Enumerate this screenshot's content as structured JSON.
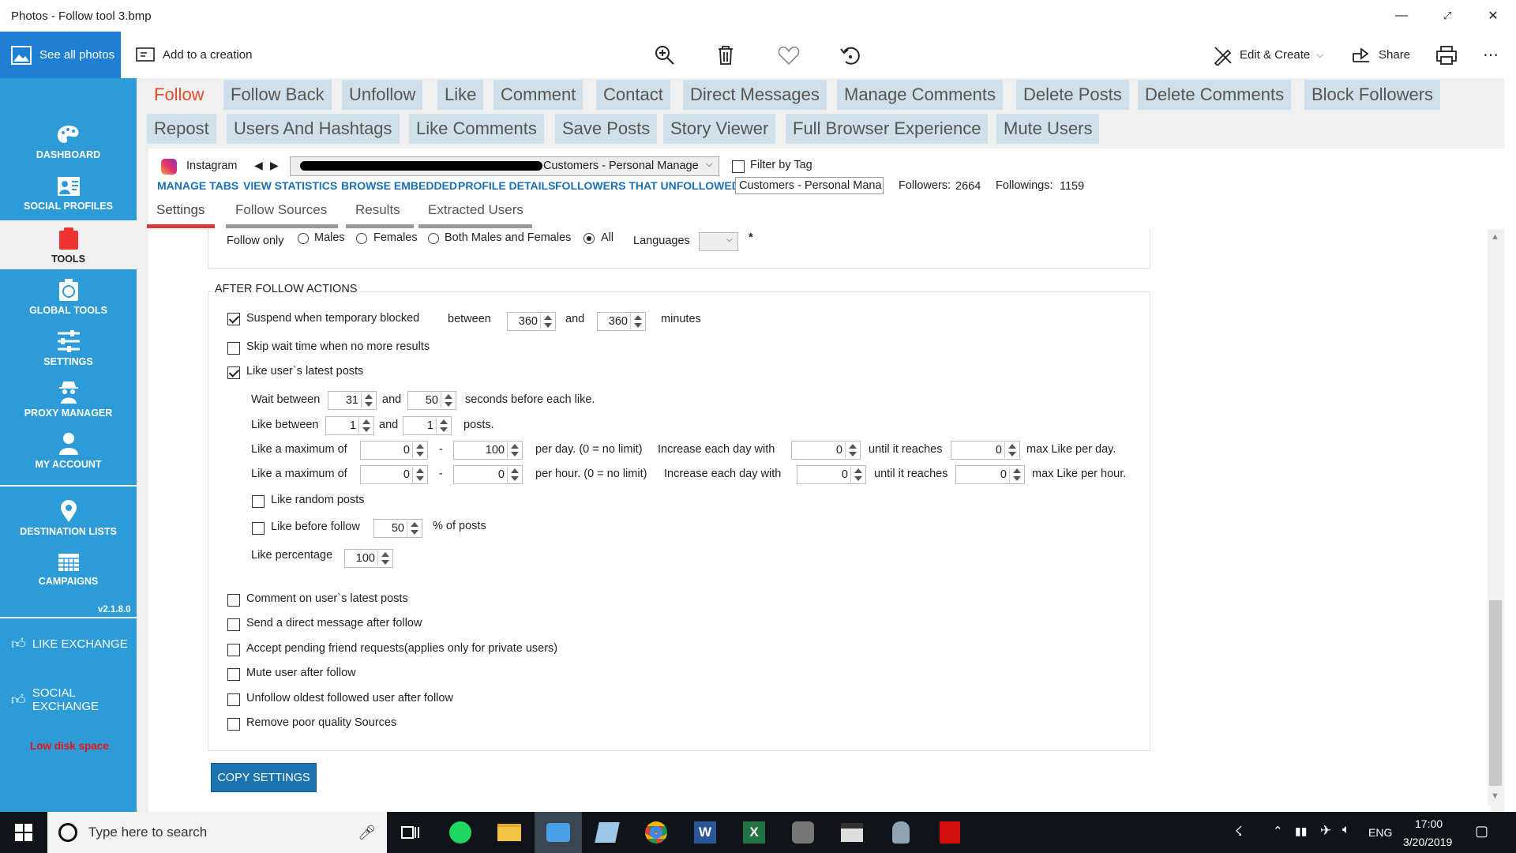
{
  "window": {
    "title": "Photos - Follow tool 3.bmp"
  },
  "photos_toolbar": {
    "see_all": "See all photos",
    "add_to_creation": "Add to a creation",
    "edit_create": "Edit & Create",
    "share": "Share"
  },
  "sidebar": {
    "items": [
      {
        "label": "DASHBOARD",
        "icon": "palette-icon"
      },
      {
        "label": "SOCIAL PROFILES",
        "icon": "profiles-icon"
      },
      {
        "label": "TOOLS",
        "icon": "clipboard-icon"
      },
      {
        "label": "GLOBAL TOOLS",
        "icon": "global-tools-icon"
      },
      {
        "label": "SETTINGS",
        "icon": "sliders-icon"
      },
      {
        "label": "PROXY MANAGER",
        "icon": "spy-icon"
      },
      {
        "label": "MY ACCOUNT",
        "icon": "user-icon"
      },
      {
        "label": "DESTINATION LISTS",
        "icon": "pin-icon"
      },
      {
        "label": "CAMPAIGNS",
        "icon": "calendar-icon"
      }
    ],
    "version": "v2.1.8.0",
    "like_exchange": "LIKE EXCHANGE",
    "social_exchange": "SOCIAL EXCHANGE",
    "warning": "Low disk space"
  },
  "tabs_row1": [
    "Follow",
    "Follow Back",
    "Unfollow",
    "Like",
    "Comment",
    "Contact",
    "Direct Messages",
    "Manage Comments",
    "Delete Posts",
    "Delete Comments",
    "Block Followers"
  ],
  "tabs_row2": [
    "Repost",
    "Users And Hashtags",
    "Like Comments",
    "Save Posts",
    "Story Viewer",
    "Full Browser Experience",
    "Mute Users"
  ],
  "account": {
    "network": "Instagram",
    "account_select": "Customers - Personal Manage",
    "filter_by_tag": "Filter by Tag",
    "tag_value": "Customers - Personal Mana",
    "followers_label": "Followers:",
    "followers": "2664",
    "followings_label": "Followings:",
    "followings": "1159",
    "links": [
      "MANAGE TABS",
      "VIEW STATISTICS",
      "BROWSE EMBEDDED",
      "PROFILE DETAILS",
      "FOLLOWERS THAT UNFOLLOWED"
    ]
  },
  "subtabs": [
    "Settings",
    "Follow Sources",
    "Results",
    "Extracted Users"
  ],
  "follow_only": {
    "label": "Follow only",
    "options": [
      "Males",
      "Females",
      "Both Males and Females",
      "All"
    ],
    "languages": "Languages",
    "asterisk": "*"
  },
  "after_follow": {
    "heading": "AFTER FOLLOW ACTIONS",
    "suspend": "Suspend when temporary blocked",
    "between": "between",
    "and": "and",
    "minutes": "minutes",
    "suspend_min": "360",
    "suspend_max": "360",
    "skip_wait": "Skip wait time when no more results",
    "like_latest": "Like user`s latest posts",
    "wait_between": "Wait between",
    "wait_min": "31",
    "wait_max": "50",
    "seconds_before": "seconds before each like.",
    "like_between": "Like between",
    "like_min": "1",
    "like_max": "1",
    "posts": "posts.",
    "like_max_of": "Like a maximum of",
    "dash": "-",
    "day_min": "0",
    "day_max": "100",
    "per_day": "per day. (0 = no limit)",
    "increase_day": "Increase each day with",
    "day_inc": "0",
    "until_reaches": "until it reaches",
    "day_reach": "0",
    "max_like_day": "max Like per day.",
    "hour_min": "0",
    "hour_max": "0",
    "per_hour": "per hour. (0 = no limit)",
    "hour_inc": "0",
    "hour_reach": "0",
    "max_like_hour": "max Like per hour.",
    "like_random": "Like random posts",
    "like_before_follow": "Like before follow",
    "before_pct": "50",
    "pct_of_posts": "% of posts",
    "like_percentage": "Like percentage",
    "like_pct_val": "100",
    "comment_latest": "Comment on user`s latest posts",
    "send_dm": "Send a direct message after follow",
    "accept_pending": "Accept pending friend requests(applies only for private users)",
    "mute_user": "Mute user after follow",
    "unfollow_oldest": "Unfollow oldest followed user after follow",
    "remove_poor": "Remove poor quality Sources"
  },
  "copy_settings": "COPY SETTINGS",
  "taskbar": {
    "search_placeholder": "Type here to search",
    "lang": "ENG",
    "time": "17:00",
    "date": "3/20/2019"
  },
  "colors": {
    "sidebar": "#2d9bd8",
    "accent": "#e64b2b",
    "tab_bg": "#cfe0ea",
    "link": "#1b6fb3"
  }
}
